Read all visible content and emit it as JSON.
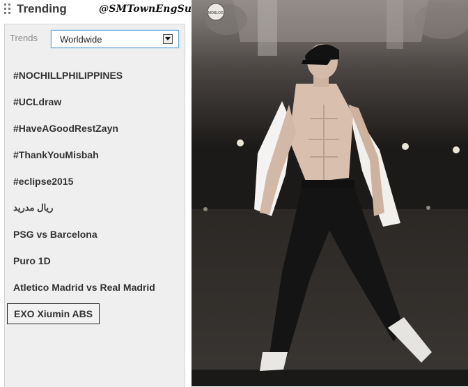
{
  "panel": {
    "title": "Trending",
    "watermark": "@SMTownEngSub",
    "trends_label": "Trends",
    "location_select": {
      "value": "Worldwide"
    },
    "items": [
      {
        "label": "#NOCHILLPHILIPPINES"
      },
      {
        "label": "#UCLdraw"
      },
      {
        "label": "#HaveAGoodRestZayn"
      },
      {
        "label": "#ThankYouMisbah"
      },
      {
        "label": "#eclipse2015"
      },
      {
        "label": "ريال مدريد"
      },
      {
        "label": "PSG vs Barcelona"
      },
      {
        "label": "Puro 1D"
      },
      {
        "label": "Atletico Madrid vs Real Madrid"
      },
      {
        "label": "EXO Xiumin ABS"
      }
    ]
  },
  "photo": {
    "badge_text": "MOBLOG",
    "palette": {
      "skin": "#d8bfae",
      "shirt": "#f4f3f1",
      "pants": "#141414",
      "cap": "#121212",
      "stage": "#2a2724"
    }
  }
}
